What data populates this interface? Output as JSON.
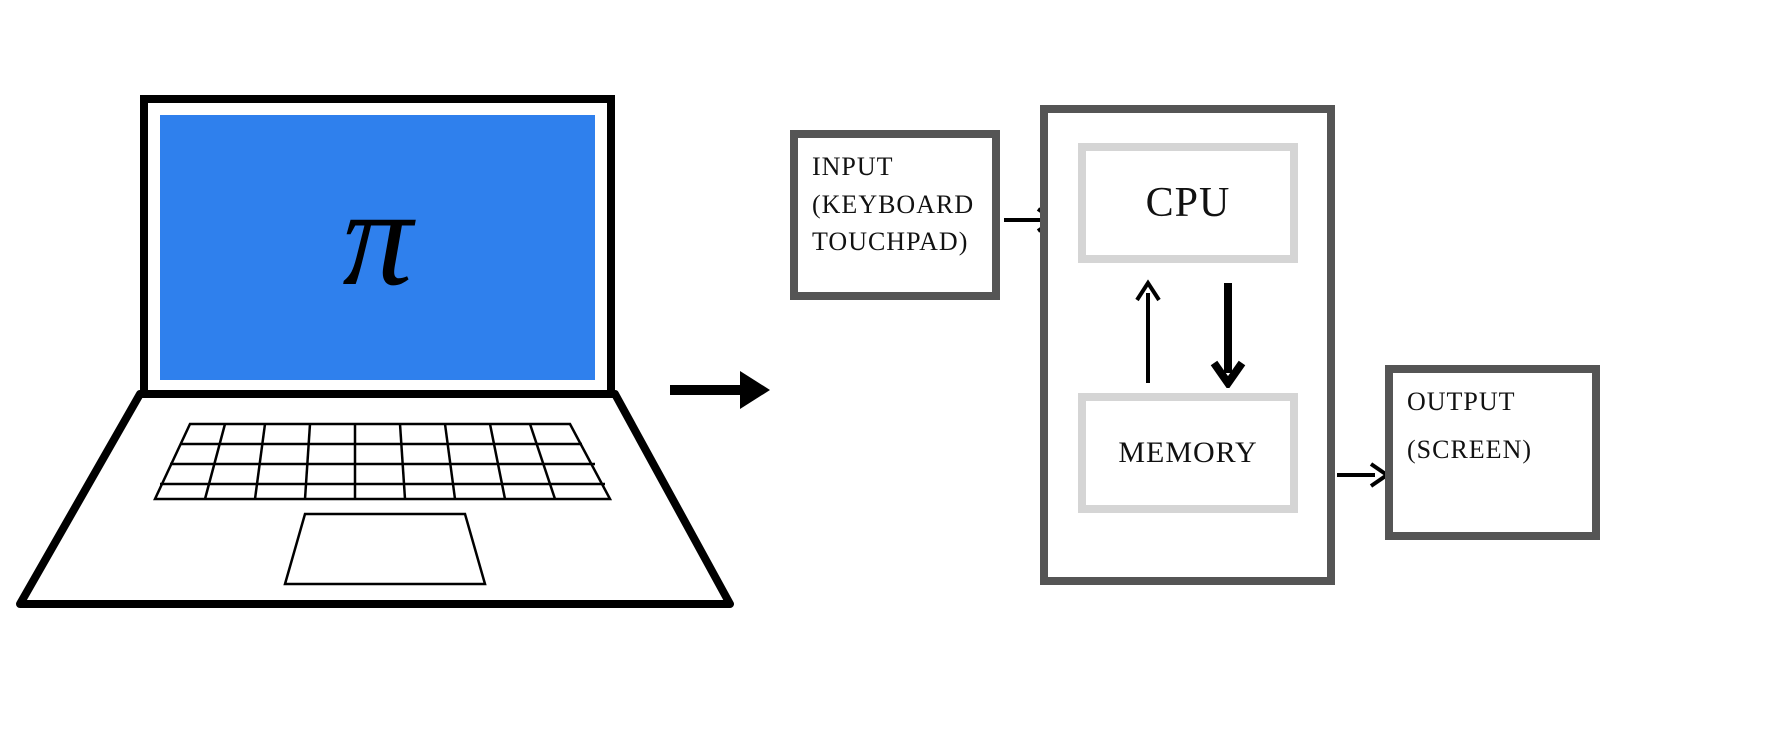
{
  "laptop": {
    "screen_symbol": "π",
    "screen_color": "#2f80ed"
  },
  "diagram": {
    "input": {
      "title": "INPUT",
      "detail_line1": "(KEYBOARD",
      "detail_line2": "TOUCHPAD)"
    },
    "processor": {
      "cpu": "CPU",
      "memory": "MEMORY"
    },
    "output": {
      "title": "OUTPUT",
      "detail": "(SCREEN)"
    }
  }
}
